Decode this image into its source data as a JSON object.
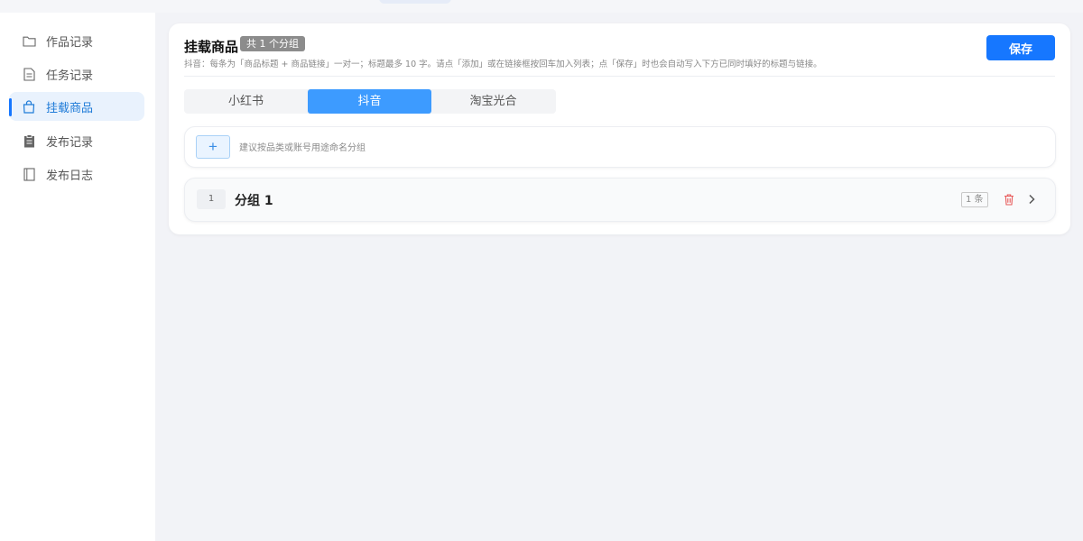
{
  "sidebar": {
    "items": [
      {
        "label": "作品记录",
        "icon": "folder-icon"
      },
      {
        "label": "任务记录",
        "icon": "document-icon"
      },
      {
        "label": "挂载商品",
        "icon": "shopping-bag-icon",
        "active": true
      },
      {
        "label": "发布记录",
        "icon": "clipboard-icon"
      },
      {
        "label": "发布日志",
        "icon": "notebook-icon"
      }
    ]
  },
  "header": {
    "title": "挂载商品",
    "count_badge": "共 1 个分组",
    "description": "抖音：每条为「商品标题 + 商品链接」一对一；标题最多 10 字。请点「添加」或在链接框按回车加入列表；点「保存」时也会自动写入下方已同时填好的标题与链接。",
    "save_label": "保存"
  },
  "tabs": [
    {
      "label": "小红书"
    },
    {
      "label": "抖音",
      "active": true
    },
    {
      "label": "淘宝光合"
    }
  ],
  "add_group": {
    "button_label": "+",
    "placeholder": "建议按品类或账号用途命名分组"
  },
  "groups": [
    {
      "index": "1",
      "name": "分组 1",
      "count": "1 条"
    }
  ],
  "colors": {
    "accent": "#1677ff",
    "active_tab": "#3d9bff",
    "active_nav_bg": "#e9f2fd",
    "danger": "#e85a5a"
  }
}
